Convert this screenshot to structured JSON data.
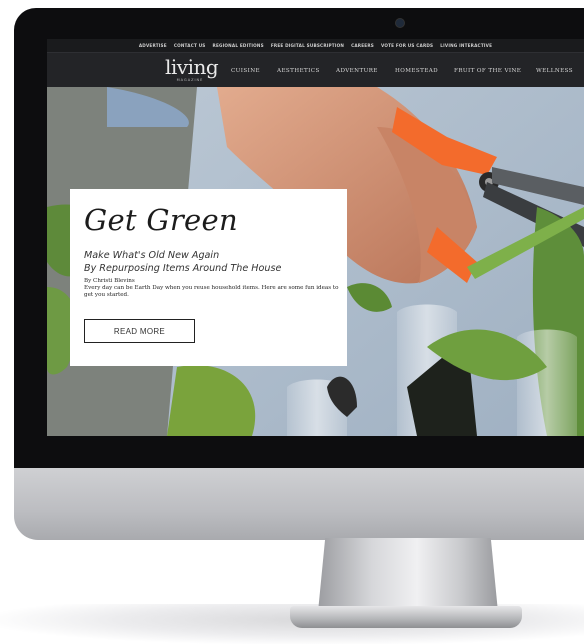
{
  "topbar": {
    "links": [
      "ADVERTISE",
      "CONTACT US",
      "REGIONAL EDITIONS",
      "FREE DIGITAL SUBSCRIPTION",
      "CAREERS",
      "VOTE FOR US CARDS",
      "LIVING INTERACTIVE"
    ]
  },
  "header": {
    "logo": "living",
    "logo_sub": "MAGAZINE",
    "nav": [
      "CUISINE",
      "AESTHETICS",
      "ADVENTURE",
      "HOMESTEAD",
      "FRUIT OF THE VINE",
      "WELLNESS"
    ]
  },
  "feature": {
    "title": "Get Green",
    "subtitle_line1": "Make What's Old New Again",
    "subtitle_line2": "By Repurposing Items Around The House",
    "author": "By Christi Blevins",
    "blurb": "Every day can be Earth Day when you reuse household items. Here are some fun ideas to get you started.",
    "button": "READ MORE"
  },
  "colors": {
    "accent_orange": "#f36b2c",
    "nav_bg": "#232427",
    "bezel": "#0d0d0f"
  }
}
